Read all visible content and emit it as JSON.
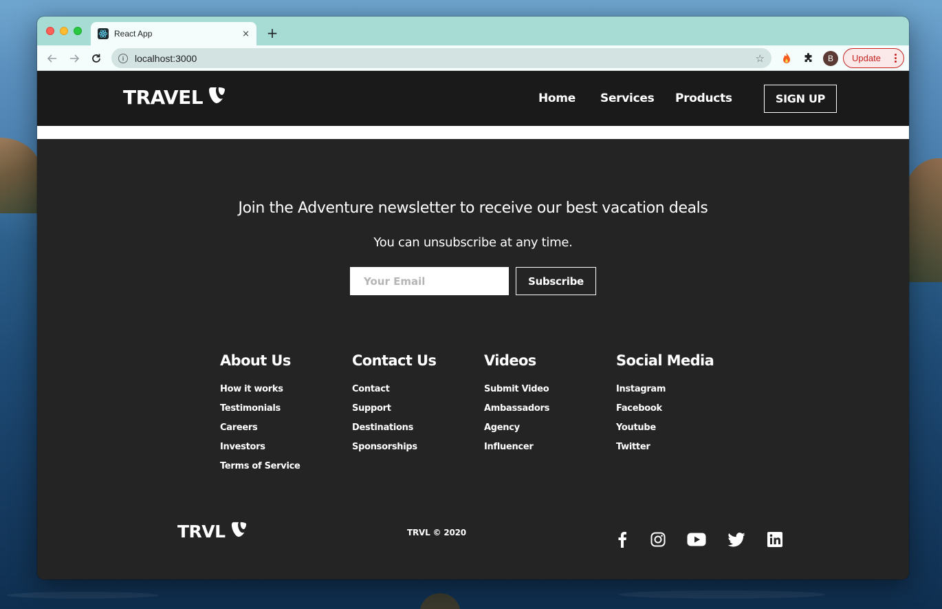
{
  "browser": {
    "tab_title": "React App",
    "tab_close": "×",
    "new_tab": "+",
    "url": "localhost:3000",
    "info_glyph": "i",
    "star_glyph": "☆",
    "avatar_letter": "B",
    "update_label": "Update",
    "colors": {
      "tabbar": "#a7dcd4",
      "update": "#c5221f"
    }
  },
  "navbar": {
    "brand": "TRAVEL",
    "brand_icon": "typo3-logo-icon",
    "links": [
      "Home",
      "Services",
      "Products"
    ],
    "signup": "SIGN UP"
  },
  "newsletter": {
    "heading": "Join the Adventure newsletter to receive our best vacation deals",
    "subtext": "You can unsubscribe at any time.",
    "email_placeholder": "Your Email",
    "email_value": "",
    "subscribe": "Subscribe"
  },
  "footer_columns": [
    {
      "title": "About Us",
      "links": [
        "How it works",
        "Testimonials",
        "Careers",
        "Investors",
        "Terms of Service"
      ]
    },
    {
      "title": "Contact Us",
      "links": [
        "Contact",
        "Support",
        "Destinations",
        "Sponsorships"
      ]
    },
    {
      "title": "Videos",
      "links": [
        "Submit Video",
        "Ambassadors",
        "Agency",
        "Influencer"
      ]
    },
    {
      "title": "Social Media",
      "links": [
        "Instagram",
        "Facebook",
        "Youtube",
        "Twitter"
      ]
    }
  ],
  "bottom": {
    "logo": "TRVL",
    "logo_icon": "typo3-logo-icon",
    "copyright": "TRVL © 2020",
    "social_icons": [
      "facebook-icon",
      "instagram-icon",
      "youtube-icon",
      "twitter-icon",
      "linkedin-icon"
    ]
  },
  "theme": {
    "navbar_bg": "#1a1a1a",
    "footer_bg": "#242424",
    "text": "#ffffff"
  }
}
